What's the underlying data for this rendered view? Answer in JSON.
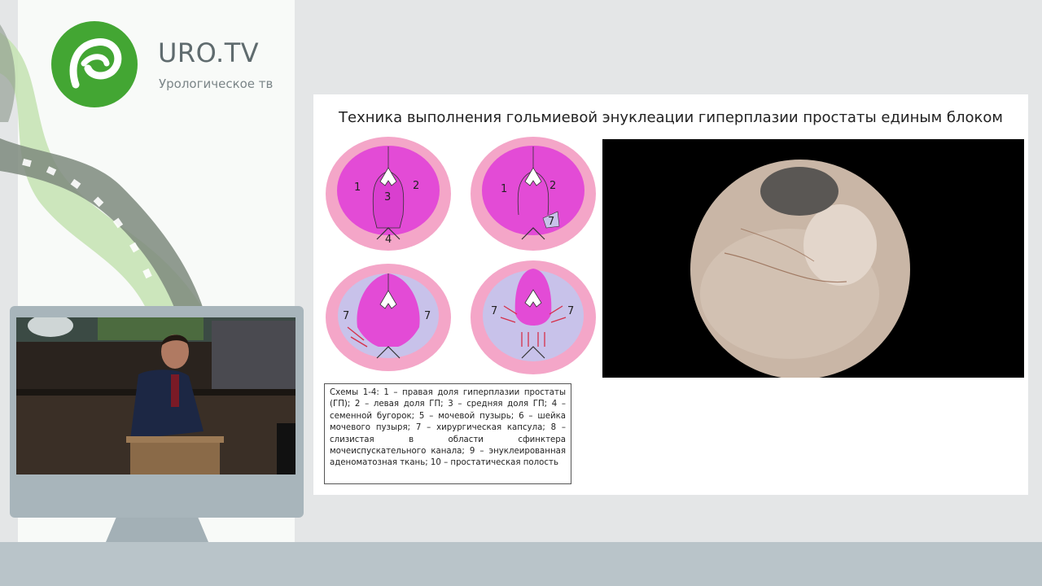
{
  "brand": {
    "name": "URO.TV",
    "tagline": "Урологическое тв",
    "logo_color": "#43a633"
  },
  "slide": {
    "title": "Техника выполнения гольмиевой энуклеации гиперплазии простаты единым блоком",
    "diagrams": [
      {
        "labels": [
          "1",
          "2",
          "3",
          "4"
        ]
      },
      {
        "labels": [
          "1",
          "2",
          "7"
        ]
      },
      {
        "labels": [
          "7",
          "7"
        ]
      },
      {
        "labels": [
          "7",
          "7"
        ]
      }
    ],
    "caption": "Схемы 1-4: 1 – правая доля гиперплазии простаты (ГП); 2 – левая доля ГП; 3 – средняя доля ГП; 4 – семенной бугорок; 5 – мочевой пузырь; 6 – шейка мочевого пузыря; 7 – хирургическая капсула; 8 – слизистая в области сфинктера мочеиспускательного канала; 9 – энуклеированная аденоматозная ткань; 10 – простатическая полость"
  },
  "colors": {
    "lobe_magenta": "#e34bd6",
    "capsule_pink": "#f4a6c8",
    "capsule_lilac": "#c8c2ea",
    "arrow_red": "#d6304a",
    "bottom_bar": "#b9c4c9"
  }
}
